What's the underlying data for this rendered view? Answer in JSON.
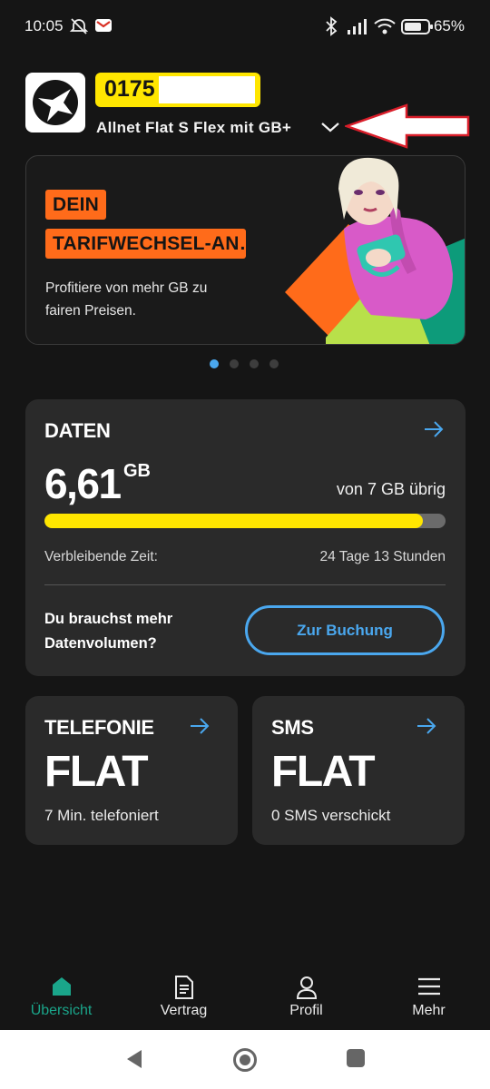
{
  "status_bar": {
    "time": "10:05",
    "battery": "65%"
  },
  "header": {
    "number_prefix": "0175",
    "tariff_name": "Allnet Flat S Flex mit GB+"
  },
  "promo": {
    "tag_line1": "DEIN",
    "tag_line2": "TARIFWECHSEL-AN…",
    "text": "Profitiere von mehr GB zu fairen Preisen.",
    "slide_count": 4,
    "active_slide": 0
  },
  "data_card": {
    "title": "DATEN",
    "amount": "6,61",
    "unit": "GB",
    "total": "von 7 GB übrig",
    "remaining_fraction": 0.944,
    "remaining_label": "Verbleibende Zeit:",
    "remaining_value": "24 Tage 13 Stunden",
    "upsell_text": "Du brauchst mehr Datenvolumen?",
    "button_label": "Zur Buchung"
  },
  "telefonie_card": {
    "title": "TELEFONIE",
    "value": "FLAT",
    "sub": "7 Min. telefoniert"
  },
  "sms_card": {
    "title": "SMS",
    "value": "FLAT",
    "sub": "0 SMS verschickt"
  },
  "bottom_nav": {
    "items": [
      {
        "label": "Übersicht",
        "icon": "home-icon",
        "active": true
      },
      {
        "label": "Vertrag",
        "icon": "document-icon",
        "active": false
      },
      {
        "label": "Profil",
        "icon": "person-icon",
        "active": false
      },
      {
        "label": "Mehr",
        "icon": "menu-icon",
        "active": false
      }
    ]
  },
  "colors": {
    "background": "#151515",
    "card": "#2a2a2a",
    "accent_yellow": "#ffe600",
    "accent_blue": "#4aa7ee",
    "accent_orange": "#ff6b1a",
    "active_green": "#1aa58a"
  }
}
